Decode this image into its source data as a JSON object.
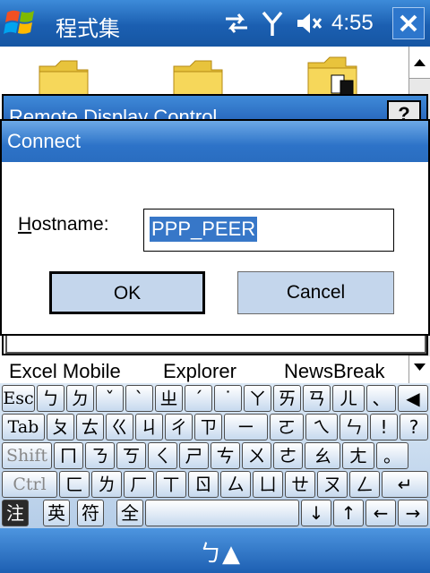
{
  "titlebar": {
    "title": "程式集",
    "time": "4:55",
    "close": "✕"
  },
  "background_dialog": {
    "title": "Remote Display Control",
    "help": "?"
  },
  "connect": {
    "title": "Connect",
    "hostname_label_first": "H",
    "hostname_label_rest": "ostname:",
    "hostname_value": "PPP_PEER",
    "ok": "OK",
    "cancel": "Cancel"
  },
  "programs": [
    "Excel Mobile",
    "Explorer",
    "NewsBreak"
  ],
  "keyboard": {
    "row1": [
      "Esc",
      "ㄅ",
      "ㄉ",
      "ˇ",
      "ˋ",
      "ㄓ",
      "ˊ",
      "˙",
      "ㄚ",
      "ㄞ",
      "ㄢ",
      "ㄦ",
      "、",
      "◀"
    ],
    "row2": [
      "Tab",
      "ㄆ",
      "ㄊ",
      "ㄍ",
      "ㄐ",
      "ㄔ",
      "ㄗ",
      "ㄧ",
      "ㄛ",
      "ㄟ",
      "ㄣ",
      "!",
      "?"
    ],
    "row3": [
      "Shift",
      "ㄇ",
      "ㄋ",
      "ㄎ",
      "ㄑ",
      "ㄕ",
      "ㄘ",
      "ㄨ",
      "ㄜ",
      "ㄠ",
      "ㄤ",
      "。"
    ],
    "row4": [
      "Ctrl",
      "ㄈ",
      "ㄌ",
      "ㄏ",
      "ㄒ",
      "ㄖ",
      "ㄙ",
      "ㄩ",
      "ㄝ",
      "ㄡ",
      "ㄥ",
      "↵"
    ],
    "row5": [
      "注",
      "英",
      "符",
      "全",
      "",
      "↓",
      "↑",
      "←",
      "→"
    ]
  },
  "bottom": {
    "input_method": "ㄅ▲"
  }
}
